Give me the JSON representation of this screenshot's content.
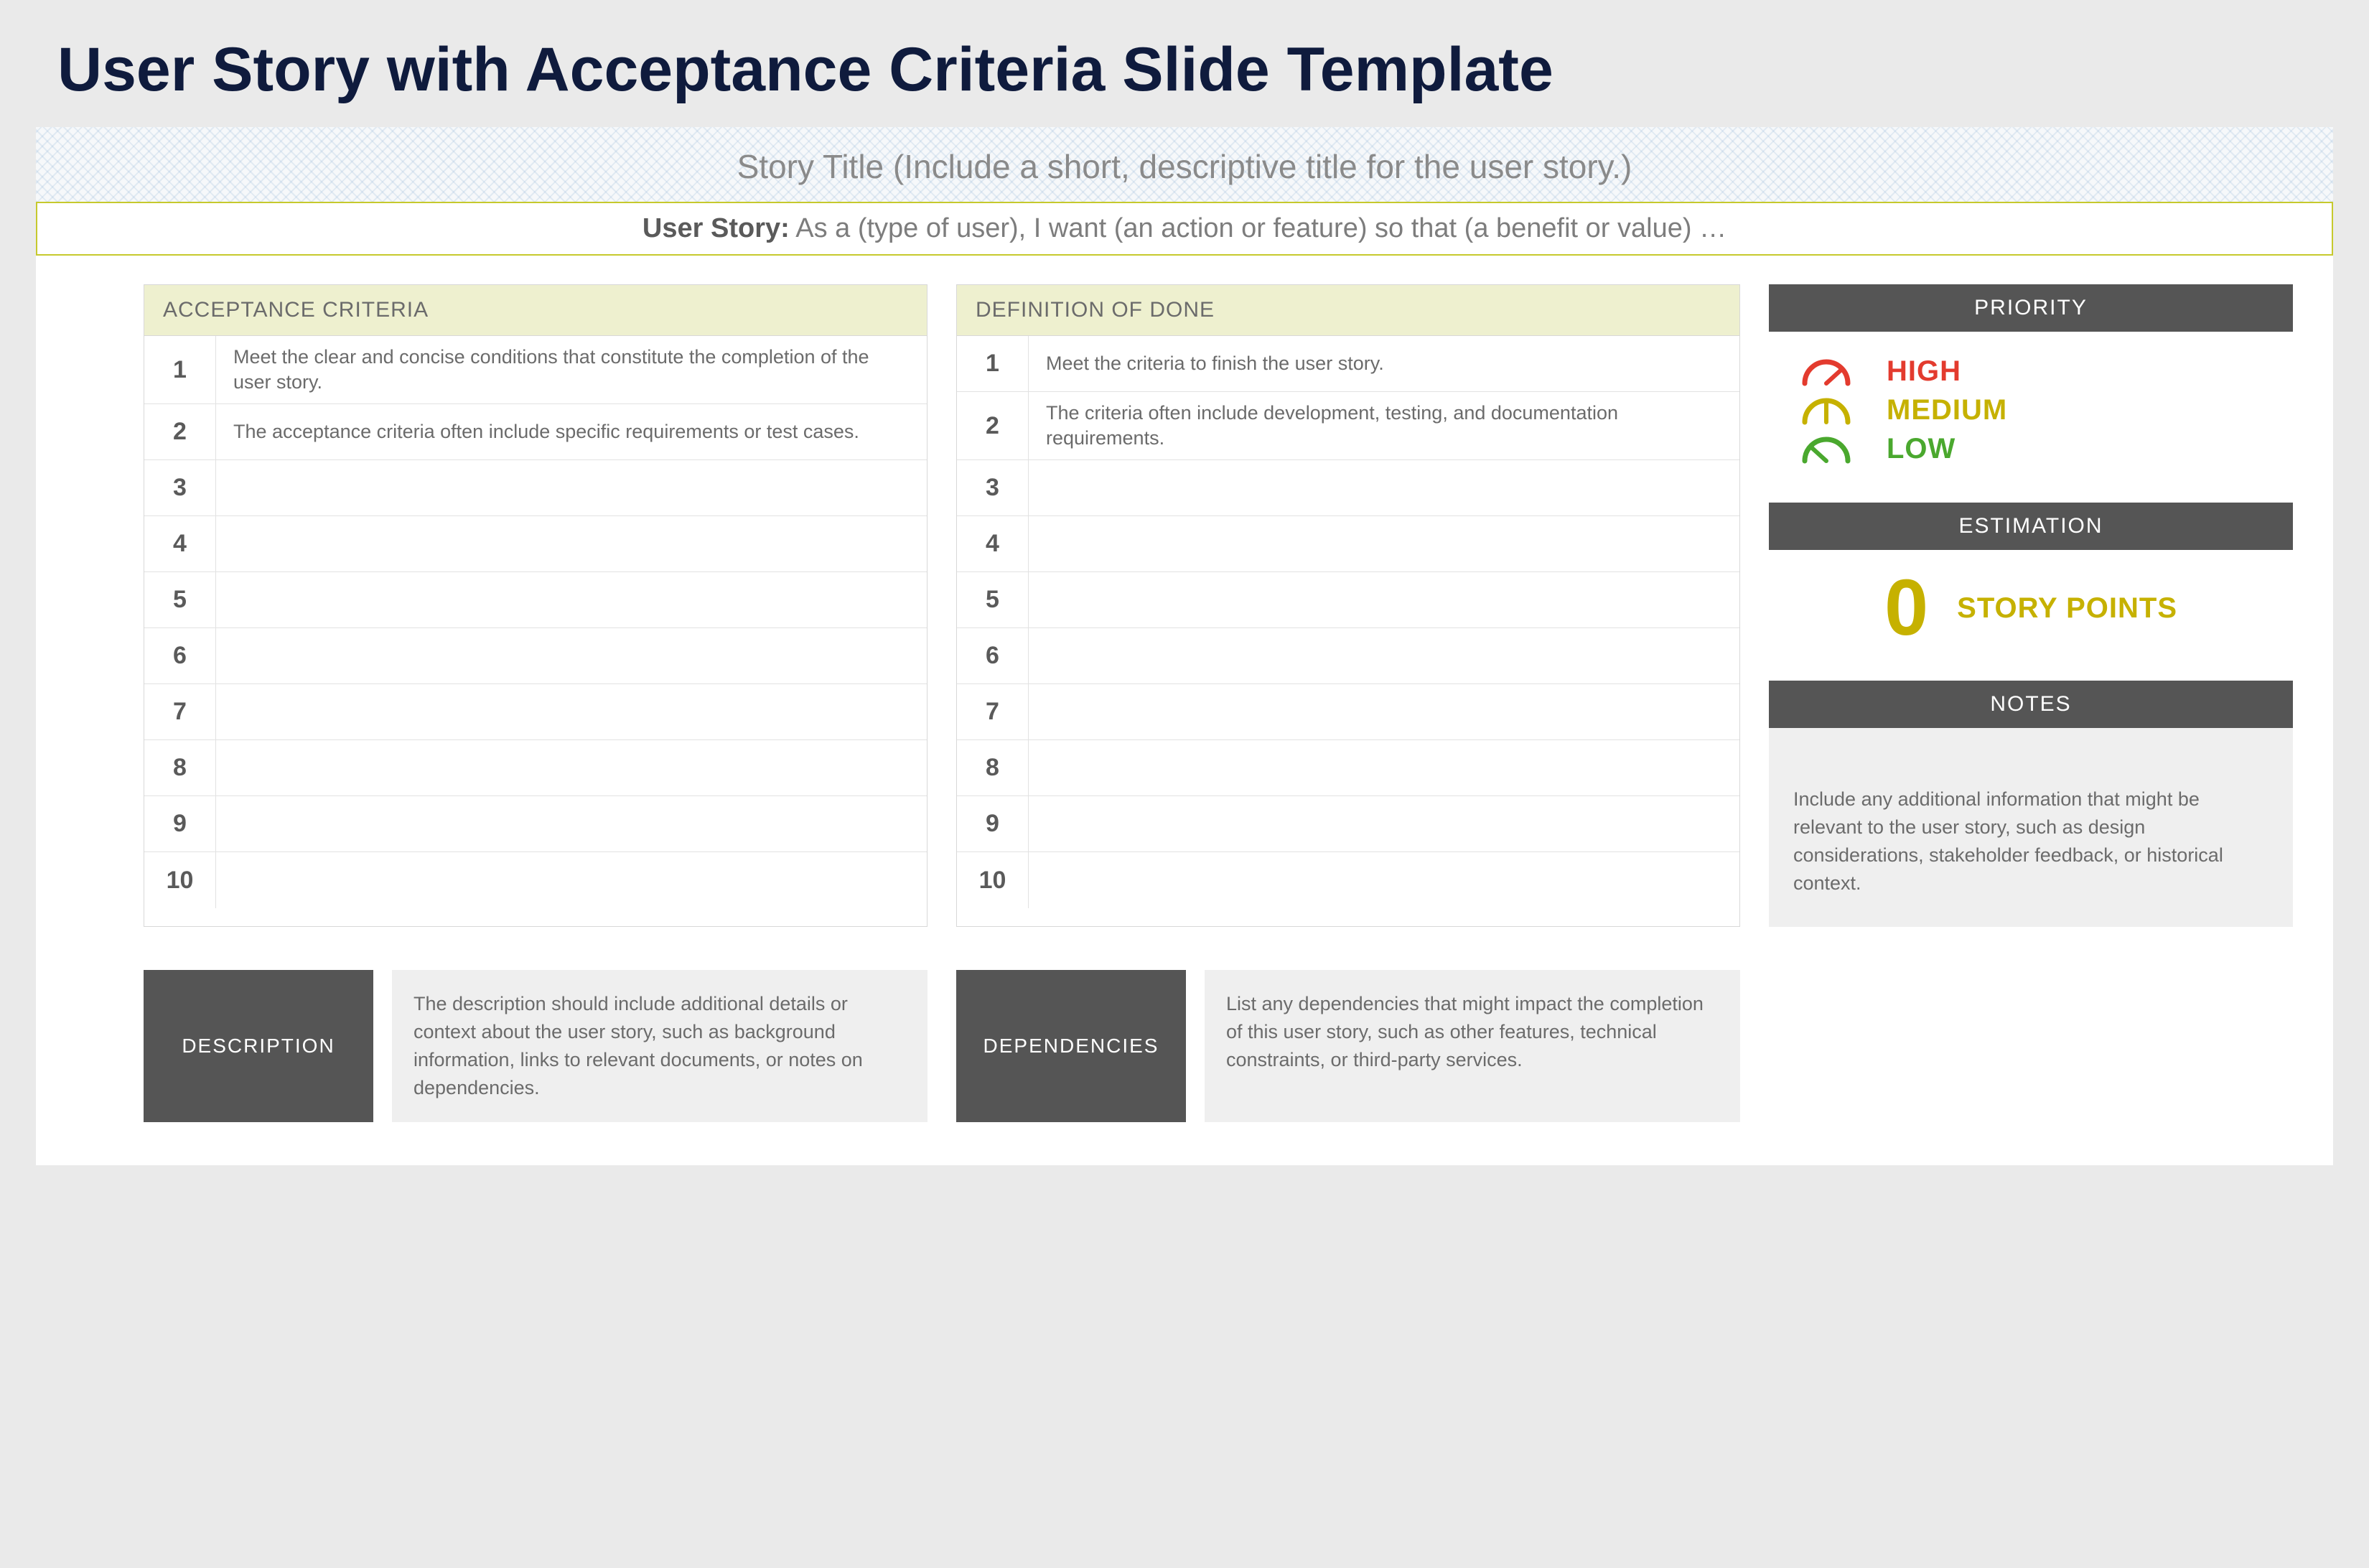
{
  "page": {
    "title": "User Story with Acceptance Criteria Slide Template"
  },
  "header": {
    "story_title": "Story Title (Include a short, descriptive title for the user story.)",
    "user_story_label": "User Story:",
    "user_story_text": " As a (type of user), I want (an action or feature) so that (a benefit or value) …"
  },
  "acceptance": {
    "title": "ACCEPTANCE CRITERIA",
    "rows": [
      {
        "n": "1",
        "text": "Meet the clear and concise conditions that constitute the completion of the user story."
      },
      {
        "n": "2",
        "text": "The acceptance criteria often include specific requirements or test cases."
      },
      {
        "n": "3",
        "text": ""
      },
      {
        "n": "4",
        "text": ""
      },
      {
        "n": "5",
        "text": ""
      },
      {
        "n": "6",
        "text": ""
      },
      {
        "n": "7",
        "text": ""
      },
      {
        "n": "8",
        "text": ""
      },
      {
        "n": "9",
        "text": ""
      },
      {
        "n": "10",
        "text": ""
      }
    ]
  },
  "definition": {
    "title": "DEFINITION OF DONE",
    "rows": [
      {
        "n": "1",
        "text": "Meet the criteria to finish the user story."
      },
      {
        "n": "2",
        "text": "The criteria often include development, testing, and documentation requirements."
      },
      {
        "n": "3",
        "text": ""
      },
      {
        "n": "4",
        "text": ""
      },
      {
        "n": "5",
        "text": ""
      },
      {
        "n": "6",
        "text": ""
      },
      {
        "n": "7",
        "text": ""
      },
      {
        "n": "8",
        "text": ""
      },
      {
        "n": "9",
        "text": ""
      },
      {
        "n": "10",
        "text": ""
      }
    ]
  },
  "priority": {
    "title": "PRIORITY",
    "high": "HIGH",
    "medium": "MEDIUM",
    "low": "LOW"
  },
  "estimation": {
    "title": "ESTIMATION",
    "value": "0",
    "label": "STORY POINTS"
  },
  "notes": {
    "title": "NOTES",
    "text": "Include any additional information that might be relevant to the user story, such as design considerations, stakeholder feedback, or historical context."
  },
  "description": {
    "label": "DESCRIPTION",
    "text": "The description should include additional details or context about the user story, such as background information, links to relevant documents, or notes on dependencies."
  },
  "dependencies": {
    "label": "DEPENDENCIES",
    "text": "List any dependencies that might impact the completion of this user story, such as other features, technical constraints, or third-party services."
  }
}
